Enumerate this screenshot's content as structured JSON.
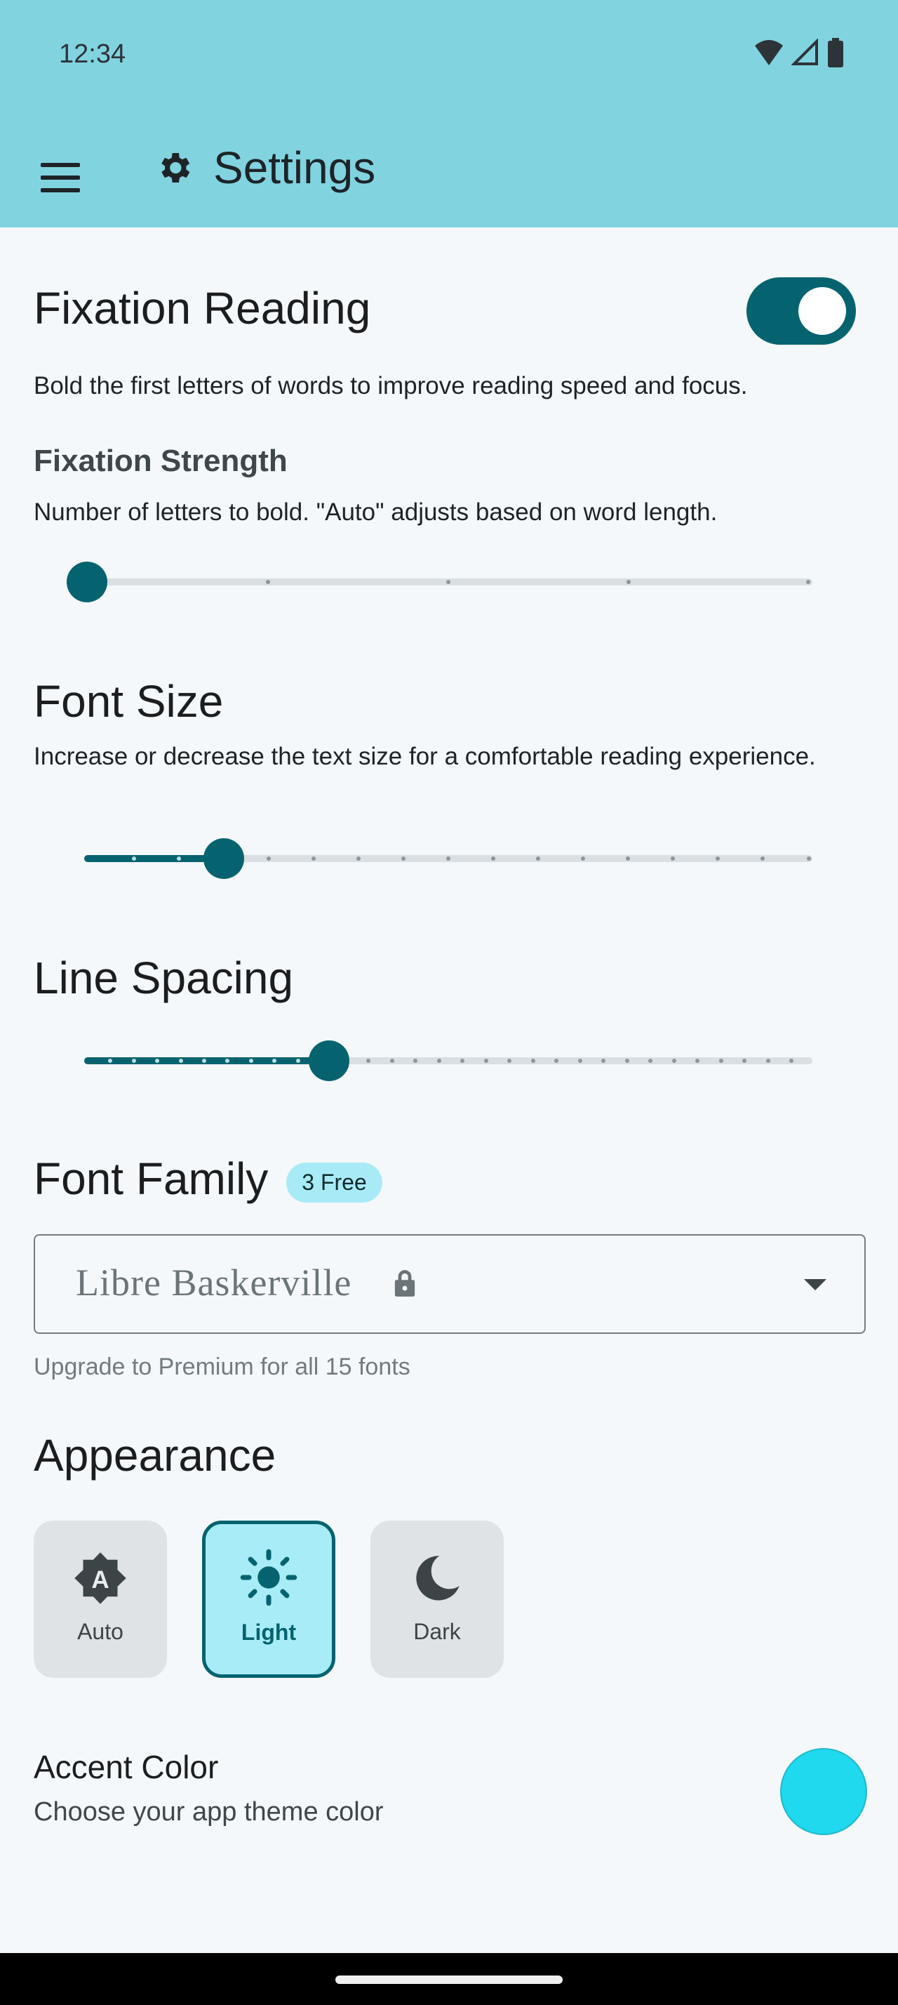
{
  "status_bar": {
    "time": "12:34"
  },
  "app_bar": {
    "title": "Settings",
    "icons": [
      "menu-icon",
      "gear-icon"
    ]
  },
  "fixation": {
    "title": "Fixation Reading",
    "enabled": true,
    "description": "Bold the first letters of words to improve reading speed and focus.",
    "strength_title": "Fixation Strength",
    "strength_description": "Number of letters to bold. \"Auto\" adjusts based on word length.",
    "strength_slider": {
      "steps": 5,
      "value_index": 0
    }
  },
  "font_size": {
    "title": "Font Size",
    "description": "Increase or decrease the text size for a comfortable reading experience.",
    "slider": {
      "steps": 17,
      "value_index": 3
    }
  },
  "line_spacing": {
    "title": "Line Spacing",
    "slider": {
      "steps": 32,
      "value_index": 11
    }
  },
  "font_family": {
    "title": "Font Family",
    "badge": "3 Free",
    "selected": "Libre Baskerville",
    "helper": "Upgrade to Premium for all 15 fonts",
    "icons": [
      "lock-icon",
      "dropdown-caret-icon"
    ]
  },
  "appearance": {
    "title": "Appearance",
    "modes": [
      {
        "label": "Auto",
        "icon": "auto-brightness-icon",
        "selected": false
      },
      {
        "label": "Light",
        "icon": "sun-icon",
        "selected": true
      },
      {
        "label": "Dark",
        "icon": "moon-icon",
        "selected": false
      }
    ]
  },
  "accent": {
    "title": "Accent Color",
    "description": "Choose your app theme color",
    "color": "#1fd9ee"
  },
  "colors": {
    "primary": "#05636f",
    "app_bar": "#82d3e0",
    "background": "#f4f8fb"
  }
}
